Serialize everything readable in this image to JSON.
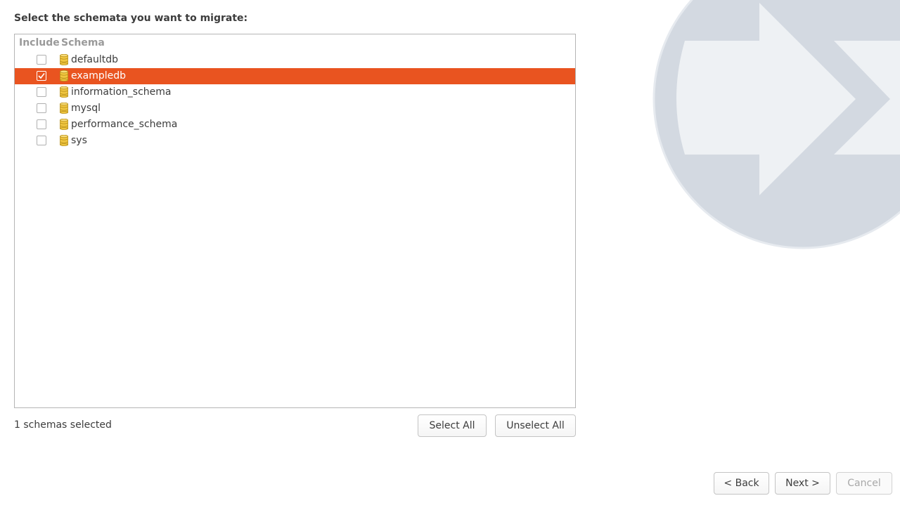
{
  "heading": "Select the schemata you want to migrate:",
  "tree": {
    "columns": {
      "include": "Include",
      "schema": "Schema"
    },
    "rows": [
      {
        "label": "defaultdb",
        "checked": false,
        "selected": false
      },
      {
        "label": "exampledb",
        "checked": true,
        "selected": true
      },
      {
        "label": "information_schema",
        "checked": false,
        "selected": false
      },
      {
        "label": "mysql",
        "checked": false,
        "selected": false
      },
      {
        "label": "performance_schema",
        "checked": false,
        "selected": false
      },
      {
        "label": "sys",
        "checked": false,
        "selected": false
      }
    ],
    "icon": "database-icon"
  },
  "status": "1 schemas selected",
  "buttons": {
    "select_all": "Select All",
    "unselect_all": "Unselect All",
    "back": "< Back",
    "next": "Next >",
    "cancel": "Cancel"
  },
  "colors": {
    "selection": "#e95420",
    "watermark": "#d3d9e1",
    "database_icon": "#f0c640"
  }
}
